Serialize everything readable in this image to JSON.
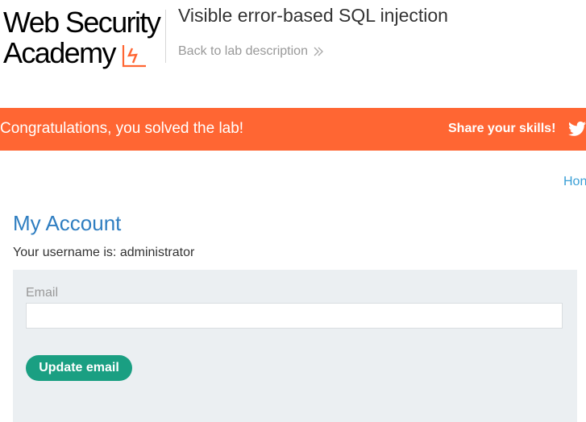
{
  "header": {
    "logo_line1": "Web Security",
    "logo_line2": "Academy",
    "lab_title": "Visible error-based SQL injection",
    "back_link_label": "Back to lab description"
  },
  "banner": {
    "message": "Congratulations, you solved the lab!",
    "share_label": "Share your skills!",
    "share_icon": "twitter-icon"
  },
  "nav": {
    "home_label": "Hon"
  },
  "main": {
    "title": "My Account",
    "username_prefix": "Your username is: ",
    "username": "administrator",
    "form": {
      "email_label": "Email",
      "email_value": "",
      "email_placeholder": "",
      "submit_label": "Update email"
    }
  },
  "colors": {
    "banner_bg": "#ff6633",
    "title_blue": "#2f7ec1",
    "button_green": "#1a9f82",
    "panel_bg": "#ebeff2",
    "link_blue": "#3a9fd6"
  }
}
